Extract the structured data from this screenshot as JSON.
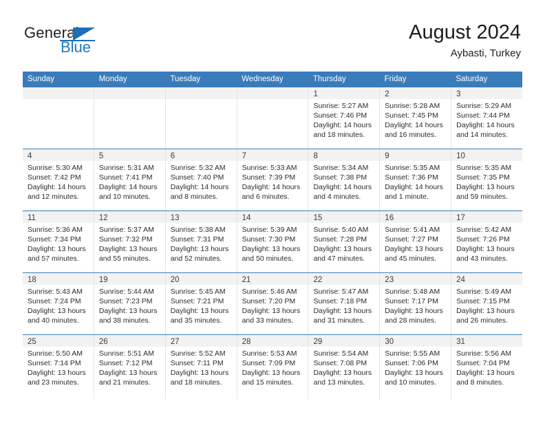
{
  "brand": {
    "name_part1": "General",
    "name_part2": "Blue"
  },
  "header": {
    "title": "August 2024",
    "subtitle": "Aybasti, Turkey"
  },
  "weekdays": [
    "Sunday",
    "Monday",
    "Tuesday",
    "Wednesday",
    "Thursday",
    "Friday",
    "Saturday"
  ],
  "colors": {
    "header_blue": "#3a7cba",
    "brand_blue": "#1f7ac0",
    "daynum_band": "#f2f2f2"
  },
  "weeks": [
    [
      {
        "day": "",
        "lines": []
      },
      {
        "day": "",
        "lines": []
      },
      {
        "day": "",
        "lines": []
      },
      {
        "day": "",
        "lines": []
      },
      {
        "day": "1",
        "lines": [
          "Sunrise: 5:27 AM",
          "Sunset: 7:46 PM",
          "Daylight: 14 hours",
          "and 18 minutes."
        ]
      },
      {
        "day": "2",
        "lines": [
          "Sunrise: 5:28 AM",
          "Sunset: 7:45 PM",
          "Daylight: 14 hours",
          "and 16 minutes."
        ]
      },
      {
        "day": "3",
        "lines": [
          "Sunrise: 5:29 AM",
          "Sunset: 7:44 PM",
          "Daylight: 14 hours",
          "and 14 minutes."
        ]
      }
    ],
    [
      {
        "day": "4",
        "lines": [
          "Sunrise: 5:30 AM",
          "Sunset: 7:42 PM",
          "Daylight: 14 hours",
          "and 12 minutes."
        ]
      },
      {
        "day": "5",
        "lines": [
          "Sunrise: 5:31 AM",
          "Sunset: 7:41 PM",
          "Daylight: 14 hours",
          "and 10 minutes."
        ]
      },
      {
        "day": "6",
        "lines": [
          "Sunrise: 5:32 AM",
          "Sunset: 7:40 PM",
          "Daylight: 14 hours",
          "and 8 minutes."
        ]
      },
      {
        "day": "7",
        "lines": [
          "Sunrise: 5:33 AM",
          "Sunset: 7:39 PM",
          "Daylight: 14 hours",
          "and 6 minutes."
        ]
      },
      {
        "day": "8",
        "lines": [
          "Sunrise: 5:34 AM",
          "Sunset: 7:38 PM",
          "Daylight: 14 hours",
          "and 4 minutes."
        ]
      },
      {
        "day": "9",
        "lines": [
          "Sunrise: 5:35 AM",
          "Sunset: 7:36 PM",
          "Daylight: 14 hours",
          "and 1 minute."
        ]
      },
      {
        "day": "10",
        "lines": [
          "Sunrise: 5:35 AM",
          "Sunset: 7:35 PM",
          "Daylight: 13 hours",
          "and 59 minutes."
        ]
      }
    ],
    [
      {
        "day": "11",
        "lines": [
          "Sunrise: 5:36 AM",
          "Sunset: 7:34 PM",
          "Daylight: 13 hours",
          "and 57 minutes."
        ]
      },
      {
        "day": "12",
        "lines": [
          "Sunrise: 5:37 AM",
          "Sunset: 7:32 PM",
          "Daylight: 13 hours",
          "and 55 minutes."
        ]
      },
      {
        "day": "13",
        "lines": [
          "Sunrise: 5:38 AM",
          "Sunset: 7:31 PM",
          "Daylight: 13 hours",
          "and 52 minutes."
        ]
      },
      {
        "day": "14",
        "lines": [
          "Sunrise: 5:39 AM",
          "Sunset: 7:30 PM",
          "Daylight: 13 hours",
          "and 50 minutes."
        ]
      },
      {
        "day": "15",
        "lines": [
          "Sunrise: 5:40 AM",
          "Sunset: 7:28 PM",
          "Daylight: 13 hours",
          "and 47 minutes."
        ]
      },
      {
        "day": "16",
        "lines": [
          "Sunrise: 5:41 AM",
          "Sunset: 7:27 PM",
          "Daylight: 13 hours",
          "and 45 minutes."
        ]
      },
      {
        "day": "17",
        "lines": [
          "Sunrise: 5:42 AM",
          "Sunset: 7:26 PM",
          "Daylight: 13 hours",
          "and 43 minutes."
        ]
      }
    ],
    [
      {
        "day": "18",
        "lines": [
          "Sunrise: 5:43 AM",
          "Sunset: 7:24 PM",
          "Daylight: 13 hours",
          "and 40 minutes."
        ]
      },
      {
        "day": "19",
        "lines": [
          "Sunrise: 5:44 AM",
          "Sunset: 7:23 PM",
          "Daylight: 13 hours",
          "and 38 minutes."
        ]
      },
      {
        "day": "20",
        "lines": [
          "Sunrise: 5:45 AM",
          "Sunset: 7:21 PM",
          "Daylight: 13 hours",
          "and 35 minutes."
        ]
      },
      {
        "day": "21",
        "lines": [
          "Sunrise: 5:46 AM",
          "Sunset: 7:20 PM",
          "Daylight: 13 hours",
          "and 33 minutes."
        ]
      },
      {
        "day": "22",
        "lines": [
          "Sunrise: 5:47 AM",
          "Sunset: 7:18 PM",
          "Daylight: 13 hours",
          "and 31 minutes."
        ]
      },
      {
        "day": "23",
        "lines": [
          "Sunrise: 5:48 AM",
          "Sunset: 7:17 PM",
          "Daylight: 13 hours",
          "and 28 minutes."
        ]
      },
      {
        "day": "24",
        "lines": [
          "Sunrise: 5:49 AM",
          "Sunset: 7:15 PM",
          "Daylight: 13 hours",
          "and 26 minutes."
        ]
      }
    ],
    [
      {
        "day": "25",
        "lines": [
          "Sunrise: 5:50 AM",
          "Sunset: 7:14 PM",
          "Daylight: 13 hours",
          "and 23 minutes."
        ]
      },
      {
        "day": "26",
        "lines": [
          "Sunrise: 5:51 AM",
          "Sunset: 7:12 PM",
          "Daylight: 13 hours",
          "and 21 minutes."
        ]
      },
      {
        "day": "27",
        "lines": [
          "Sunrise: 5:52 AM",
          "Sunset: 7:11 PM",
          "Daylight: 13 hours",
          "and 18 minutes."
        ]
      },
      {
        "day": "28",
        "lines": [
          "Sunrise: 5:53 AM",
          "Sunset: 7:09 PM",
          "Daylight: 13 hours",
          "and 15 minutes."
        ]
      },
      {
        "day": "29",
        "lines": [
          "Sunrise: 5:54 AM",
          "Sunset: 7:08 PM",
          "Daylight: 13 hours",
          "and 13 minutes."
        ]
      },
      {
        "day": "30",
        "lines": [
          "Sunrise: 5:55 AM",
          "Sunset: 7:06 PM",
          "Daylight: 13 hours",
          "and 10 minutes."
        ]
      },
      {
        "day": "31",
        "lines": [
          "Sunrise: 5:56 AM",
          "Sunset: 7:04 PM",
          "Daylight: 13 hours",
          "and 8 minutes."
        ]
      }
    ]
  ]
}
